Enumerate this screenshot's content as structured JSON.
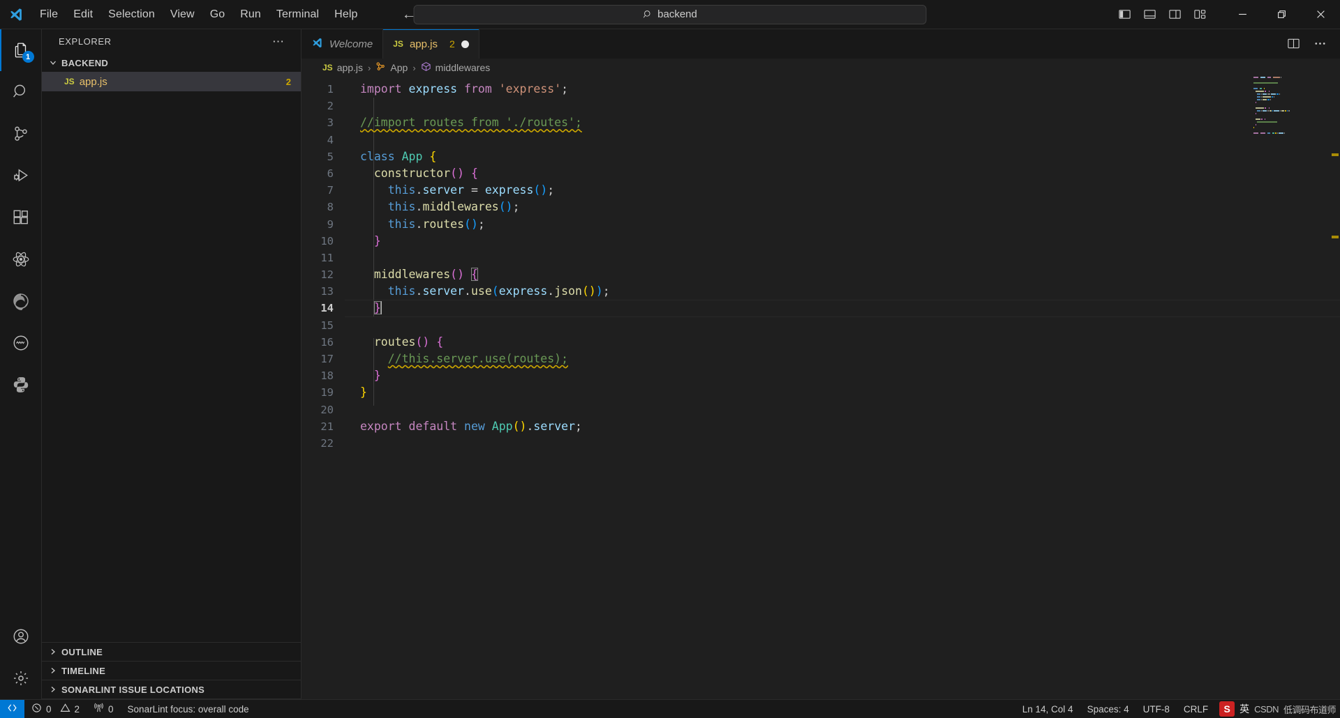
{
  "titlebar": {
    "logo_icon": "vscode-logo-icon",
    "menus": [
      "File",
      "Edit",
      "Selection",
      "View",
      "Go",
      "Run",
      "Terminal",
      "Help"
    ],
    "nav_back_icon": "arrow-left-icon",
    "nav_forward_icon": "arrow-right-icon",
    "command_center": {
      "search_icon": "search-icon",
      "text": "backend"
    },
    "layout_icons": [
      "toggle-primary-sidebar-icon",
      "toggle-panel-icon",
      "toggle-secondary-sidebar-icon",
      "customize-layout-icon"
    ],
    "window_controls": {
      "minimize": "minimize-icon",
      "restore": "restore-icon",
      "close": "close-icon"
    }
  },
  "activitybar": {
    "items": [
      {
        "name": "explorer",
        "icon": "files-icon",
        "active": true,
        "badge": "1"
      },
      {
        "name": "search",
        "icon": "search-icon",
        "active": false,
        "badge": ""
      },
      {
        "name": "source-control",
        "icon": "source-control-icon",
        "active": false,
        "badge": ""
      },
      {
        "name": "run-and-debug",
        "icon": "debug-icon",
        "active": false,
        "badge": ""
      },
      {
        "name": "extensions",
        "icon": "extensions-icon",
        "active": false,
        "badge": ""
      },
      {
        "name": "react-devtools",
        "icon": "react-atom-icon",
        "active": false,
        "badge": ""
      },
      {
        "name": "edge-tools",
        "icon": "edge-browser-icon",
        "active": false,
        "badge": ""
      },
      {
        "name": "sonarlint",
        "icon": "sonarlint-circle-icon",
        "active": false,
        "badge": ""
      },
      {
        "name": "python",
        "icon": "python-icon",
        "active": false,
        "badge": ""
      }
    ],
    "bottom_items": [
      {
        "name": "accounts",
        "icon": "account-icon"
      },
      {
        "name": "manage",
        "icon": "gear-icon"
      }
    ]
  },
  "sidebar": {
    "title": "EXPLORER",
    "more_actions_icon": "ellipsis-icon",
    "folder": {
      "label": "BACKEND",
      "expanded": true,
      "chevron_icon": "chevron-down-icon"
    },
    "files": [
      {
        "icon": "js-file-icon",
        "icon_label": "JS",
        "name": "app.js",
        "problems": "2",
        "selected": true
      }
    ],
    "bottom_panels": [
      {
        "label": "OUTLINE",
        "chevron_icon": "chevron-right-icon"
      },
      {
        "label": "TIMELINE",
        "chevron_icon": "chevron-right-icon"
      },
      {
        "label": "SONARLINT ISSUE LOCATIONS",
        "chevron_icon": "chevron-right-icon"
      }
    ]
  },
  "editor": {
    "tabs": [
      {
        "label": "Welcome",
        "icon": "vscode-logo-icon",
        "active": false,
        "count": "",
        "dirty": false
      },
      {
        "label": "app.js",
        "icon": "js-file-icon",
        "icon_label": "JS",
        "active": true,
        "count": "2",
        "dirty": true
      }
    ],
    "tabbar_actions": [
      "split-editor-icon",
      "more-actions-icon"
    ],
    "breadcrumbs": [
      {
        "label": "app.js",
        "icon": "js-file-icon",
        "icon_label": "JS"
      },
      {
        "label": "App",
        "icon": "symbol-class-icon"
      },
      {
        "label": "middlewares",
        "icon": "symbol-method-icon"
      }
    ],
    "language": "javascript",
    "total_lines": 22,
    "cursor_line": 14,
    "code_lines": [
      {
        "n": 1,
        "tokens": [
          {
            "t": "import",
            "c": "t-kw"
          },
          {
            "t": " ",
            "c": "t-pun"
          },
          {
            "t": "express",
            "c": "t-id"
          },
          {
            "t": " ",
            "c": "t-pun"
          },
          {
            "t": "from",
            "c": "t-kw"
          },
          {
            "t": " ",
            "c": "t-pun"
          },
          {
            "t": "'express'",
            "c": "t-str"
          },
          {
            "t": ";",
            "c": "t-pun"
          }
        ]
      },
      {
        "n": 2,
        "tokens": []
      },
      {
        "n": 3,
        "tokens": [
          {
            "t": "//import routes from './routes';",
            "c": "t-cmt squiggle"
          }
        ]
      },
      {
        "n": 4,
        "tokens": []
      },
      {
        "n": 5,
        "tokens": [
          {
            "t": "class",
            "c": "t-kw2"
          },
          {
            "t": " ",
            "c": "t-pun"
          },
          {
            "t": "App",
            "c": "t-cls"
          },
          {
            "t": " ",
            "c": "t-pun"
          },
          {
            "t": "{",
            "c": "t-p1"
          }
        ]
      },
      {
        "n": 6,
        "tokens": [
          {
            "t": "  ",
            "c": "t-pun"
          },
          {
            "t": "constructor",
            "c": "t-fn"
          },
          {
            "t": "()",
            "c": "t-p2"
          },
          {
            "t": " ",
            "c": "t-pun"
          },
          {
            "t": "{",
            "c": "t-p2"
          }
        ]
      },
      {
        "n": 7,
        "tokens": [
          {
            "t": "    ",
            "c": "t-pun"
          },
          {
            "t": "this",
            "c": "t-kw2"
          },
          {
            "t": ".",
            "c": "t-pun"
          },
          {
            "t": "server",
            "c": "t-id"
          },
          {
            "t": " = ",
            "c": "t-pun"
          },
          {
            "t": "express",
            "c": "t-id"
          },
          {
            "t": "()",
            "c": "t-p3"
          },
          {
            "t": ";",
            "c": "t-pun"
          }
        ]
      },
      {
        "n": 8,
        "tokens": [
          {
            "t": "    ",
            "c": "t-pun"
          },
          {
            "t": "this",
            "c": "t-kw2"
          },
          {
            "t": ".",
            "c": "t-pun"
          },
          {
            "t": "middlewares",
            "c": "t-fn"
          },
          {
            "t": "()",
            "c": "t-p3"
          },
          {
            "t": ";",
            "c": "t-pun"
          }
        ]
      },
      {
        "n": 9,
        "tokens": [
          {
            "t": "    ",
            "c": "t-pun"
          },
          {
            "t": "this",
            "c": "t-kw2"
          },
          {
            "t": ".",
            "c": "t-pun"
          },
          {
            "t": "routes",
            "c": "t-fn"
          },
          {
            "t": "()",
            "c": "t-p3"
          },
          {
            "t": ";",
            "c": "t-pun"
          }
        ]
      },
      {
        "n": 10,
        "tokens": [
          {
            "t": "  ",
            "c": "t-pun"
          },
          {
            "t": "}",
            "c": "t-p2"
          }
        ]
      },
      {
        "n": 11,
        "tokens": []
      },
      {
        "n": 12,
        "tokens": [
          {
            "t": "  ",
            "c": "t-pun"
          },
          {
            "t": "middlewares",
            "c": "t-fn"
          },
          {
            "t": "()",
            "c": "t-p2"
          },
          {
            "t": " ",
            "c": "t-pun"
          },
          {
            "t": "{",
            "c": "t-p2 bracket-box"
          }
        ]
      },
      {
        "n": 13,
        "tokens": [
          {
            "t": "    ",
            "c": "t-pun"
          },
          {
            "t": "this",
            "c": "t-kw2"
          },
          {
            "t": ".",
            "c": "t-pun"
          },
          {
            "t": "server",
            "c": "t-id"
          },
          {
            "t": ".",
            "c": "t-pun"
          },
          {
            "t": "use",
            "c": "t-fn"
          },
          {
            "t": "(",
            "c": "t-p3"
          },
          {
            "t": "express",
            "c": "t-id"
          },
          {
            "t": ".",
            "c": "t-pun"
          },
          {
            "t": "json",
            "c": "t-fn"
          },
          {
            "t": "()",
            "c": "t-p1"
          },
          {
            "t": ")",
            "c": "t-p3"
          },
          {
            "t": ";",
            "c": "t-pun"
          }
        ]
      },
      {
        "n": 14,
        "tokens": [
          {
            "t": "  ",
            "c": "t-pun"
          },
          {
            "t": "}",
            "c": "t-p2 bracket-box"
          }
        ],
        "current": true,
        "caret_after": true
      },
      {
        "n": 15,
        "tokens": []
      },
      {
        "n": 16,
        "tokens": [
          {
            "t": "  ",
            "c": "t-pun"
          },
          {
            "t": "routes",
            "c": "t-fn"
          },
          {
            "t": "()",
            "c": "t-p2"
          },
          {
            "t": " ",
            "c": "t-pun"
          },
          {
            "t": "{",
            "c": "t-p2"
          }
        ]
      },
      {
        "n": 17,
        "tokens": [
          {
            "t": "    ",
            "c": "t-pun"
          },
          {
            "t": "//this.server.use(routes);",
            "c": "t-cmt squiggle"
          }
        ]
      },
      {
        "n": 18,
        "tokens": [
          {
            "t": "  ",
            "c": "t-pun"
          },
          {
            "t": "}",
            "c": "t-p2"
          }
        ]
      },
      {
        "n": 19,
        "tokens": [
          {
            "t": "}",
            "c": "t-p1"
          }
        ]
      },
      {
        "n": 20,
        "tokens": []
      },
      {
        "n": 21,
        "tokens": [
          {
            "t": "export",
            "c": "t-kw"
          },
          {
            "t": " ",
            "c": "t-pun"
          },
          {
            "t": "default",
            "c": "t-kw"
          },
          {
            "t": " ",
            "c": "t-pun"
          },
          {
            "t": "new",
            "c": "t-kw2"
          },
          {
            "t": " ",
            "c": "t-pun"
          },
          {
            "t": "App",
            "c": "t-cls"
          },
          {
            "t": "()",
            "c": "t-p1"
          },
          {
            "t": ".",
            "c": "t-pun"
          },
          {
            "t": "server",
            "c": "t-id"
          },
          {
            "t": ";",
            "c": "t-pun"
          }
        ]
      },
      {
        "n": 22,
        "tokens": []
      }
    ]
  },
  "statusbar": {
    "remote_icon": "remote-window-icon",
    "errors_icon": "error-icon",
    "errors": "0",
    "warnings_icon": "warning-icon",
    "warnings": "2",
    "ports_icon": "radio-tower-icon",
    "ports": "0",
    "message": "SonarLint focus: overall code",
    "cursor_position": "Ln 14, Col 4",
    "indentation": "Spaces: 4",
    "encoding": "UTF-8",
    "eol": "CRLF",
    "ime": {
      "badge": "S",
      "mode": "英",
      "tools": "CSDN",
      "extra": "低调码布道师"
    }
  },
  "colors": {
    "accent": "#0078d4",
    "warning": "#cca700",
    "editor_bg": "#1f1f1f",
    "chrome_bg": "#181818",
    "selection_bg": "#37373d"
  }
}
